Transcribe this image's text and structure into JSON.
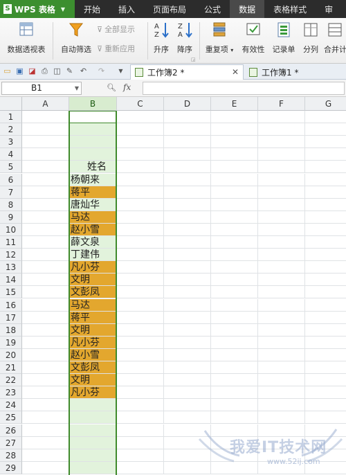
{
  "app": {
    "name": "WPS 表格"
  },
  "menu": [
    "开始",
    "插入",
    "页面布局",
    "公式",
    "数据",
    "表格样式",
    "审"
  ],
  "menu_active": "数据",
  "ribbon": {
    "pivot": "数据透视表",
    "autofilter": "自动筛选",
    "show_all": "全部显示",
    "reapply": "重新应用",
    "sort_asc": "升序",
    "sort_desc": "降序",
    "duplicates": "重复项",
    "validity": "有效性",
    "record": "记录单",
    "split": "分列",
    "consolidate": "合并计"
  },
  "doc_tabs": [
    {
      "label": "工作簿2 *",
      "active": true
    },
    {
      "label": "工作簿1 *",
      "active": false
    }
  ],
  "name_box": "B1",
  "fx_label": "fx",
  "columns": [
    "A",
    "B",
    "C",
    "D",
    "E",
    "F",
    "G"
  ],
  "rows": [
    "1",
    "2",
    "3",
    "4",
    "5",
    "6",
    "7",
    "8",
    "9",
    "10",
    "11",
    "12",
    "13",
    "14",
    "15",
    "16",
    "17",
    "18",
    "19",
    "20",
    "21",
    "22",
    "23",
    "24",
    "25",
    "26",
    "27",
    "28",
    "29"
  ],
  "column_b": [
    {
      "row": 1,
      "text": ""
    },
    {
      "row": 2,
      "text": ""
    },
    {
      "row": 3,
      "text": ""
    },
    {
      "row": 4,
      "text": ""
    },
    {
      "row": 5,
      "text": "姓名"
    },
    {
      "row": 6,
      "text": "杨朝来"
    },
    {
      "row": 7,
      "text": "蒋平",
      "highlight": true
    },
    {
      "row": 8,
      "text": "唐灿华"
    },
    {
      "row": 9,
      "text": "马达",
      "highlight": true
    },
    {
      "row": 10,
      "text": "赵小雪",
      "highlight": true
    },
    {
      "row": 11,
      "text": "薛文泉"
    },
    {
      "row": 12,
      "text": "丁建伟"
    },
    {
      "row": 13,
      "text": "凡小芬",
      "highlight": true
    },
    {
      "row": 14,
      "text": "文明",
      "highlight": true
    },
    {
      "row": 15,
      "text": "文彭凤",
      "highlight": true
    },
    {
      "row": 16,
      "text": "马达",
      "highlight": true
    },
    {
      "row": 17,
      "text": "蒋平",
      "highlight": true
    },
    {
      "row": 18,
      "text": "文明",
      "highlight": true
    },
    {
      "row": 19,
      "text": "凡小芬",
      "highlight": true
    },
    {
      "row": 20,
      "text": "赵小雪",
      "highlight": true
    },
    {
      "row": 21,
      "text": "文彭凤",
      "highlight": true
    },
    {
      "row": 22,
      "text": "文明",
      "highlight": true
    },
    {
      "row": 23,
      "text": "凡小芬",
      "highlight": true
    },
    {
      "row": 24,
      "text": ""
    },
    {
      "row": 25,
      "text": ""
    },
    {
      "row": 26,
      "text": ""
    },
    {
      "row": 27,
      "text": ""
    },
    {
      "row": 28,
      "text": ""
    },
    {
      "row": 29,
      "text": ""
    }
  ],
  "colors": {
    "duplicate_fill": "#e3a72e",
    "selected_column": "#e2f3dc",
    "selection_border": "#3f8a2b",
    "app_green": "#3c8f2f"
  },
  "watermark": {
    "text": "我爱IT技术网",
    "url": "www.52ij.com"
  }
}
